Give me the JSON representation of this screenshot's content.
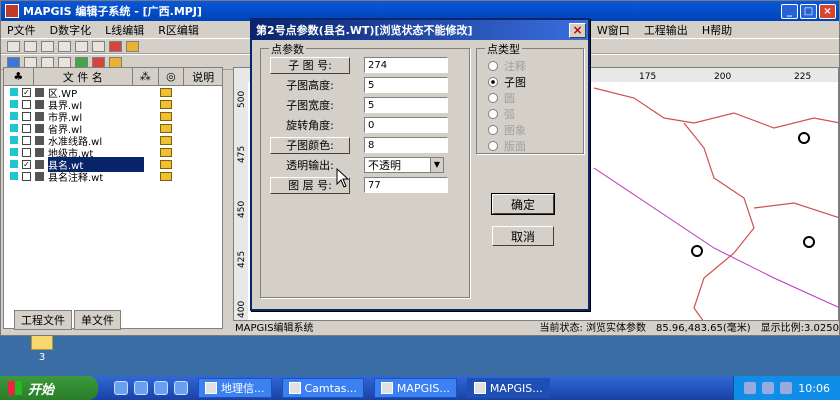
{
  "main_window": {
    "title": "MAPGIS 编辑子系统 - [广西.MPJ]",
    "menu": [
      "P文件",
      "D数字化",
      "L线编辑",
      "R区编辑",
      "W窗口",
      "工程输出",
      "H帮助"
    ],
    "controls": {
      "minimize": "_",
      "maximize": "□",
      "close": "×"
    }
  },
  "left_panel": {
    "headers": {
      "col_file": "文 件 名",
      "col_desc": "说明"
    },
    "files": [
      {
        "name": "区.WP",
        "checked": true,
        "selected": false
      },
      {
        "name": "县界.wl",
        "checked": false,
        "selected": false
      },
      {
        "name": "市界.wl",
        "checked": false,
        "selected": false
      },
      {
        "name": "省界.wl",
        "checked": false,
        "selected": false
      },
      {
        "name": "水准线路.wl",
        "checked": false,
        "selected": false
      },
      {
        "name": "地级市.wt",
        "checked": false,
        "selected": false
      },
      {
        "name": "县名.wt",
        "checked": true,
        "selected": true
      },
      {
        "name": "县名注释.wt",
        "checked": false,
        "selected": false
      }
    ],
    "tabs": [
      "工程文件",
      "单文件"
    ]
  },
  "map": {
    "ruler_top": [
      "175",
      "200",
      "225"
    ],
    "ruler_left": [
      "500",
      "475",
      "450",
      "425",
      "400"
    ]
  },
  "status": {
    "left": "MAPGIS编辑系统",
    "state": "当前状态: 浏览实体参数",
    "coords": "85.96,483.65(毫米)",
    "scale": "显示比例:3.0250"
  },
  "dialog": {
    "title": "第2号点参数(县名.WT)[浏览状态不能修改]",
    "point_params_title": "点参数",
    "point_type_title": "点类型",
    "params": [
      {
        "label": "子 图 号:",
        "value": "274",
        "button": true
      },
      {
        "label": "子图高度:",
        "value": "5",
        "button": false
      },
      {
        "label": "子图宽度:",
        "value": "5",
        "button": false
      },
      {
        "label": "旋转角度:",
        "value": "0",
        "button": false
      },
      {
        "label": "子图颜色:",
        "value": "8",
        "button": true
      },
      {
        "label": "透明输出:",
        "value": "不透明",
        "button": false
      },
      {
        "label": "图 层 号:",
        "value": "77",
        "button": true
      }
    ],
    "types": [
      {
        "label": "注释",
        "selected": false,
        "enabled": false
      },
      {
        "label": "子图",
        "selected": true,
        "enabled": true
      },
      {
        "label": "圆",
        "selected": false,
        "enabled": false
      },
      {
        "label": "弧",
        "selected": false,
        "enabled": false
      },
      {
        "label": "图象",
        "selected": false,
        "enabled": false
      },
      {
        "label": "版面",
        "selected": false,
        "enabled": false
      }
    ],
    "ok_label": "确定",
    "cancel_label": "取消",
    "close_label": "×"
  },
  "taskbar": {
    "start_label": "开始",
    "tasks": [
      "地理信...",
      "Camtas...",
      "MAPGIS...",
      "MAPGIS..."
    ],
    "clock": "10:06"
  },
  "desktop": {
    "icon_label": "3"
  },
  "colors": {
    "title_blue": "#0a58d8",
    "dialog_title": "#0a246a",
    "boundary_red": "#d05050",
    "boundary_magenta": "#c030c0",
    "taskbar": "#3168d5"
  }
}
